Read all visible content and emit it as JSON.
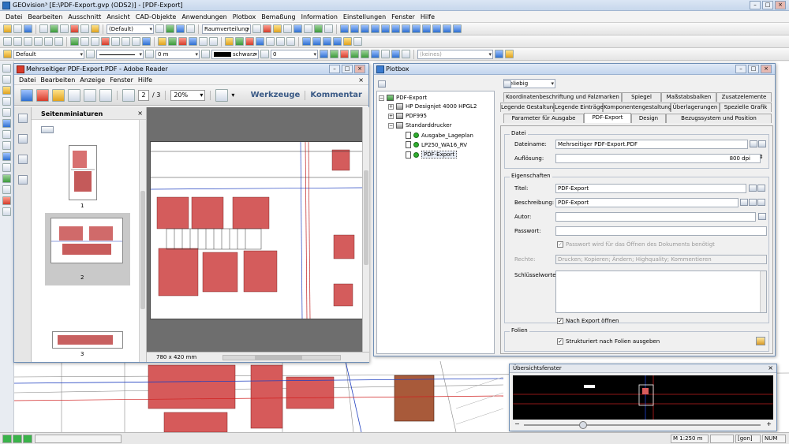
{
  "app": {
    "title": "GEOvision³ [E:\\PDF-Export.gvp (ODS2)] - [PDF-Export]",
    "menu": [
      "Datei",
      "Bearbeiten",
      "Ausschnitt",
      "Ansicht",
      "CAD-Objekte",
      "Anwendungen",
      "Plotbox",
      "Bemaßung",
      "Information",
      "Einstellungen",
      "Fenster",
      "Hilfe"
    ],
    "toolbar1": {
      "layer_combo": "(Default)",
      "room_combo": "Raumverteilung"
    },
    "toolbar3": {
      "style_combo": "Default",
      "offset_value": "0 m",
      "color_label": "schwarz",
      "number_value": "0",
      "keines_combo": "(keines)"
    }
  },
  "adobe": {
    "title": "Mehrseitiger PDF-Export.PDF - Adobe Reader",
    "menu": [
      "Datei",
      "Bearbeiten",
      "Anzeige",
      "Fenster",
      "Hilfe"
    ],
    "page_current": "2",
    "page_total": "/ 3",
    "zoom": "20%",
    "tools_link": "Werkzeuge",
    "comment_link": "Kommentar",
    "thumbs_title": "Seitenminiaturen",
    "thumbs": [
      {
        "label": "1"
      },
      {
        "label": "2"
      },
      {
        "label": "3"
      }
    ],
    "page_size": "780 x 420 mm"
  },
  "plotbox": {
    "title": "Plotbox",
    "filter_combo": "Beliebig",
    "tree": {
      "root": "PDF-Export",
      "items": [
        "HP Designjet 4000 HPGL2",
        "PDF995",
        "Standarddrucker"
      ],
      "children": [
        "Ausgabe_Lageplan",
        "LP250_WA16_RV",
        "PDF-Export"
      ]
    },
    "tabs_row1": [
      "Koordinatenbeschriftung und Falzmarken",
      "Spiegel",
      "Maßstabsbalken",
      "Zusatzelemente"
    ],
    "tabs_row2": [
      "Legende Gestaltung",
      "Legende Einträge",
      "Komponentengestaltung",
      "Überlagerungen",
      "Spezielle Grafik"
    ],
    "tabs_row3": [
      "Parameter für Ausgabe",
      "PDF-Export",
      "Design",
      "Bezugssystem und Position"
    ],
    "groups": {
      "datei": "Datei",
      "eigenschaften": "Eigenschaften",
      "folien": "Folien"
    },
    "labels": {
      "dateiname": "Dateiname:",
      "aufloesung": "Auflösung:",
      "titel": "Titel:",
      "beschreibung": "Beschreibung:",
      "autor": "Autor:",
      "passwort": "Passwort:",
      "rechte": "Rechte:",
      "schluesselworte": "Schlüsselworte:"
    },
    "values": {
      "dateiname": "Mehrseitiger PDF-Export.PDF",
      "aufloesung": "800 dpi",
      "titel": "PDF-Export",
      "beschreibung": "PDF-Export",
      "autor": "",
      "passwort": "",
      "rechte": "Drucken; Kopieren; Ändern; Highquality; Kommentieren"
    },
    "checkboxes": {
      "passwort_oeffnen": "Passwort wird für das Öffnen des Dokuments benötigt",
      "nach_export": "Nach Export öffnen",
      "strukturiert": "Strukturiert nach Folien ausgeben"
    }
  },
  "overview": {
    "title": "Übersichtsfenster"
  },
  "status": {
    "scale": "M 1:250",
    "unit": "m",
    "gon": "[gon]",
    "num": "NUM"
  }
}
